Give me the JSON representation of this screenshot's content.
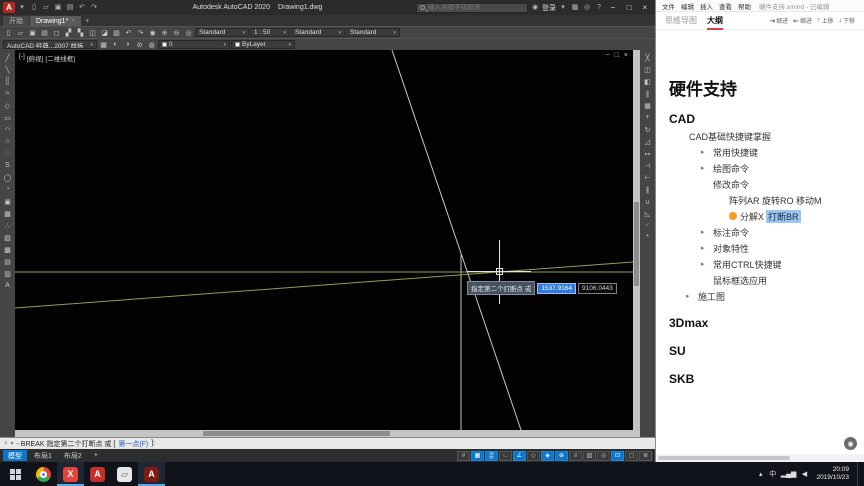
{
  "ui": {
    "caret": "▾"
  },
  "colors": {
    "acad_status_blue": "#0e76c8",
    "xmind_accent": "#d8453e",
    "marker_orange": "#f59a23",
    "selection_blue": "#9ec3ee",
    "dyn_field_blue": "#2f7bd9"
  },
  "autocad": {
    "titlebar": {
      "logo_letter": "A",
      "quick_icons": [
        {
          "n": "quick-access-dropdown-icon",
          "g": "▾"
        },
        {
          "n": "new-file-icon",
          "g": "▯"
        },
        {
          "n": "open-file-icon",
          "g": "▱"
        },
        {
          "n": "save-icon",
          "g": "▣"
        },
        {
          "n": "plot-icon",
          "g": "▤"
        },
        {
          "n": "undo-icon",
          "g": "↶"
        },
        {
          "n": "redo-icon",
          "g": "↷"
        }
      ],
      "app_title": "Autodesk AutoCAD 2020",
      "doc_title": "Drawing1.dwg",
      "search_placeholder": "键入关键字或短语",
      "user_icon": "◉",
      "signin_label": "登录",
      "right_icons": [
        {
          "n": "apps-icon",
          "g": "▦"
        },
        {
          "n": "notifications-icon",
          "g": "◎"
        },
        {
          "n": "help-icon",
          "g": "?"
        }
      ],
      "window_icons": [
        {
          "n": "minimize-icon",
          "g": "−"
        },
        {
          "n": "restore-icon",
          "g": "□"
        },
        {
          "n": "close-icon",
          "g": "×"
        }
      ]
    },
    "file_tabs": {
      "start_label": "开始",
      "drawing_label": "Drawing1*",
      "close_glyph": "×",
      "new_tab_label": "+"
    },
    "toolbar1": {
      "icons": [
        {
          "n": "new-icon",
          "g": "▯"
        },
        {
          "n": "open-icon",
          "g": "▱"
        },
        {
          "n": "save-icon",
          "g": "▣"
        },
        {
          "n": "plot-icon",
          "g": "▤"
        },
        {
          "n": "plot-preview-icon",
          "g": "◻"
        },
        {
          "n": "publish-icon",
          "g": "▞"
        },
        {
          "n": "cut-icon",
          "g": "▚"
        },
        {
          "n": "copy-clip-icon",
          "g": "◫"
        },
        {
          "n": "paste-icon",
          "g": "◪"
        },
        {
          "n": "match-properties-icon",
          "g": "▨"
        },
        {
          "n": "undo-icon",
          "g": "↶"
        },
        {
          "n": "redo-icon",
          "g": "↷"
        },
        {
          "n": "pan-icon",
          "g": "◉"
        },
        {
          "n": "zoom-in-icon",
          "g": "⊕"
        },
        {
          "n": "zoom-out-icon",
          "g": "⊖"
        },
        {
          "n": "zoom-extents-icon",
          "g": "◎"
        }
      ],
      "text_style": "Standard",
      "scale": "1 : 50",
      "dim_style": "Standard",
      "table_style": "Standard"
    },
    "toolbar2": {
      "workspace": "AutoCAD 经典...2007 样板",
      "icons": [
        {
          "n": "layer-properties-icon",
          "g": "▦"
        },
        {
          "n": "layer-state-icon",
          "g": "◐"
        },
        {
          "n": "layer-isolate-icon",
          "g": "◑"
        },
        {
          "n": "layer-freeze-icon",
          "g": "⊘"
        },
        {
          "n": "layer-lock-icon",
          "g": "◍"
        }
      ],
      "layer_value": "0",
      "color_value": "ByLayer"
    },
    "left_toolbar": [
      {
        "n": "line-tool-icon",
        "g": "╱"
      },
      {
        "n": "construction-line-icon",
        "g": "╲"
      },
      {
        "n": "multiline-icon",
        "g": "║"
      },
      {
        "n": "polyline-icon",
        "g": "≈"
      },
      {
        "n": "polygon-icon",
        "g": "◇"
      },
      {
        "n": "rectangle-icon",
        "g": "▭"
      },
      {
        "n": "arc-icon",
        "g": "◠"
      },
      {
        "n": "circle-icon",
        "g": "○"
      },
      {
        "n": "revision-cloud-icon",
        "g": "◌"
      },
      {
        "n": "spline-icon",
        "g": "S"
      },
      {
        "n": "ellipse-icon",
        "g": "◯"
      },
      {
        "n": "ellipse-arc-icon",
        "g": "◔"
      },
      {
        "n": "insert-block-icon",
        "g": "▣"
      },
      {
        "n": "make-block-icon",
        "g": "▦"
      },
      {
        "n": "point-icon",
        "g": "∴"
      },
      {
        "n": "hatch-icon",
        "g": "▨"
      },
      {
        "n": "gradient-icon",
        "g": "▩"
      },
      {
        "n": "region-icon",
        "g": "▤"
      },
      {
        "n": "table-icon",
        "g": "▥"
      },
      {
        "n": "multiline-text-icon",
        "g": "A"
      }
    ],
    "right_toolbar": [
      {
        "n": "erase-icon",
        "g": "╳"
      },
      {
        "n": "copy-icon",
        "g": "◫"
      },
      {
        "n": "mirror-icon",
        "g": "◧"
      },
      {
        "n": "offset-icon",
        "g": "∥"
      },
      {
        "n": "array-icon",
        "g": "▦"
      },
      {
        "n": "move-icon",
        "g": "+"
      },
      {
        "n": "rotate-icon",
        "g": "↻"
      },
      {
        "n": "scale-icon",
        "g": "◿"
      },
      {
        "n": "stretch-icon",
        "g": "↦"
      },
      {
        "n": "trim-icon",
        "g": "⊣"
      },
      {
        "n": "extend-icon",
        "g": "⊢"
      },
      {
        "n": "break-icon",
        "g": "∦"
      },
      {
        "n": "join-icon",
        "g": "∪"
      },
      {
        "n": "chamfer-icon",
        "g": "◺"
      },
      {
        "n": "fillet-icon",
        "g": "◜"
      },
      {
        "n": "explode-icon",
        "g": "*"
      }
    ],
    "canvas": {
      "view_controls": [
        "[-]",
        "[俯视]",
        "[二维线框]"
      ],
      "window_icons": [
        {
          "n": "drawing-minimize-icon",
          "g": "−"
        },
        {
          "n": "drawing-restore-icon",
          "g": "□"
        },
        {
          "n": "drawing-close-icon",
          "g": "×"
        }
      ],
      "tooltip": {
        "label": "指定第二个打断点 或",
        "x_value": "1537.9164",
        "y_value": "9106.0443"
      }
    },
    "command_line": {
      "icons": [
        {
          "n": "command-close-icon",
          "g": "×"
        },
        {
          "n": "recent-commands-icon",
          "g": "▾"
        }
      ],
      "pre": "- BREAK 指定第二个打断点 或 [",
      "option": "第一点(F)",
      "post": "]:"
    },
    "bottom_bar": {
      "tabs": [
        {
          "n": "model-tab",
          "label": "模型",
          "cls": "active"
        },
        {
          "n": "layout1-tab",
          "label": "布局1"
        },
        {
          "n": "layout2-tab",
          "label": "布局2"
        },
        {
          "n": "new-layout-tab",
          "label": "+"
        }
      ],
      "status_icons": [
        {
          "n": "infer-constraints-toggle",
          "g": "#"
        },
        {
          "n": "snap-toggle",
          "g": "▦",
          "cls": "on"
        },
        {
          "n": "grid-toggle",
          "g": "▒",
          "cls": "on"
        },
        {
          "n": "ortho-toggle",
          "g": "∟"
        },
        {
          "n": "polar-tracking-toggle",
          "g": "∠",
          "cls": "on"
        },
        {
          "n": "isodraft-toggle",
          "g": "◇"
        },
        {
          "n": "object-snap-toggle",
          "g": "◈",
          "cls": "on"
        },
        {
          "n": "object-track-toggle",
          "g": "⊕",
          "cls": "on"
        },
        {
          "n": "lineweight-toggle",
          "g": "≡"
        },
        {
          "n": "transparency-toggle",
          "g": "▨"
        },
        {
          "n": "selection-cycling-toggle",
          "g": "◎"
        },
        {
          "n": "dynamic-input-toggle",
          "g": "⊡",
          "cls": "on"
        },
        {
          "n": "clean-screen-toggle",
          "g": "▢"
        },
        {
          "n": "customization-icon",
          "g": "≣"
        }
      ]
    }
  },
  "xmind": {
    "menubar": {
      "items": [
        "文件",
        "编辑",
        "插入",
        "查看",
        "帮助"
      ],
      "title": "硬件支持.xmind - 已编辑"
    },
    "tabs": [
      {
        "n": "tab-mindmap",
        "label": "思维导图"
      },
      {
        "n": "tab-outline",
        "label": "大纲",
        "cls": "active"
      }
    ],
    "tools": [
      {
        "n": "indent-button",
        "g": "⇥",
        "label": "缩进"
      },
      {
        "n": "outdent-button",
        "g": "⇤",
        "label": "缩进"
      },
      {
        "n": "move-up-button",
        "g": "↑",
        "label": "上移"
      },
      {
        "n": "move-down-button",
        "g": "↓",
        "label": "下移"
      }
    ],
    "outline": {
      "title": "硬件支持",
      "items": [
        {
          "n": "outline-item-cad",
          "text": "CAD",
          "cls": "sec"
        },
        {
          "n": "outline-item-cad-basics",
          "text": "CAD基础快捷键掌握",
          "cls": "l1"
        },
        {
          "n": "outline-item-common-shortcuts",
          "text": "常用快捷键",
          "cls": "l2",
          "arrow": "▸"
        },
        {
          "n": "outline-item-draw-commands",
          "text": "绘图命令",
          "cls": "l2",
          "arrow": "▸"
        },
        {
          "n": "outline-item-modify-commands",
          "text": "修改命令",
          "cls": "l2"
        },
        {
          "n": "outline-item-array-rotate-move",
          "text": "阵列AR 旋转RO 移动M",
          "cls": "l3"
        },
        {
          "n": "outline-item-explode-break",
          "text": "分解X",
          "highlight": "打断BR",
          "cls": "l3 dot"
        },
        {
          "n": "outline-item-dimension-commands",
          "text": "标注命令",
          "cls": "l2",
          "arrow": "▸"
        },
        {
          "n": "outline-item-object-properties",
          "text": "对象特性",
          "cls": "l2",
          "arrow": "▸"
        },
        {
          "n": "outline-item-ctrl-shortcuts",
          "text": "常用CTRL快捷键",
          "cls": "l2",
          "arrow": "▸"
        },
        {
          "n": "outline-item-mouse-selection",
          "text": "鼠标框选应用",
          "cls": "l2"
        },
        {
          "n": "outline-item-construction-drawing",
          "text": "施工图",
          "cls": "l1a",
          "arrow": "▸"
        },
        {
          "n": "outline-item-3dmax",
          "text": "3Dmax",
          "cls": "sec"
        },
        {
          "n": "outline-item-su",
          "text": "SU",
          "cls": "sec"
        },
        {
          "n": "outline-item-skb",
          "text": "SKB",
          "cls": "sec"
        }
      ]
    },
    "fab_glyph": "◉"
  },
  "taskbar": {
    "apps": [
      {
        "n": "chrome-icon",
        "cls": "chrome"
      },
      {
        "n": "xmind-icon",
        "g": "X",
        "cls": "xm open"
      },
      {
        "n": "a-app-icon",
        "g": "A",
        "cls": "reda"
      },
      {
        "n": "file-explorer-icon",
        "g": "▱",
        "cls": "fold"
      },
      {
        "n": "autocad-icon",
        "g": "A",
        "cls": "acadicon open"
      }
    ],
    "tray": [
      {
        "n": "tray-expand-icon",
        "g": "▴"
      },
      {
        "n": "ime-indicator",
        "g": "中"
      },
      {
        "n": "network-icon",
        "g": "▂▄▆"
      },
      {
        "n": "volume-icon",
        "g": "◀"
      }
    ],
    "time": "20:09",
    "date": "2019/10/23"
  }
}
